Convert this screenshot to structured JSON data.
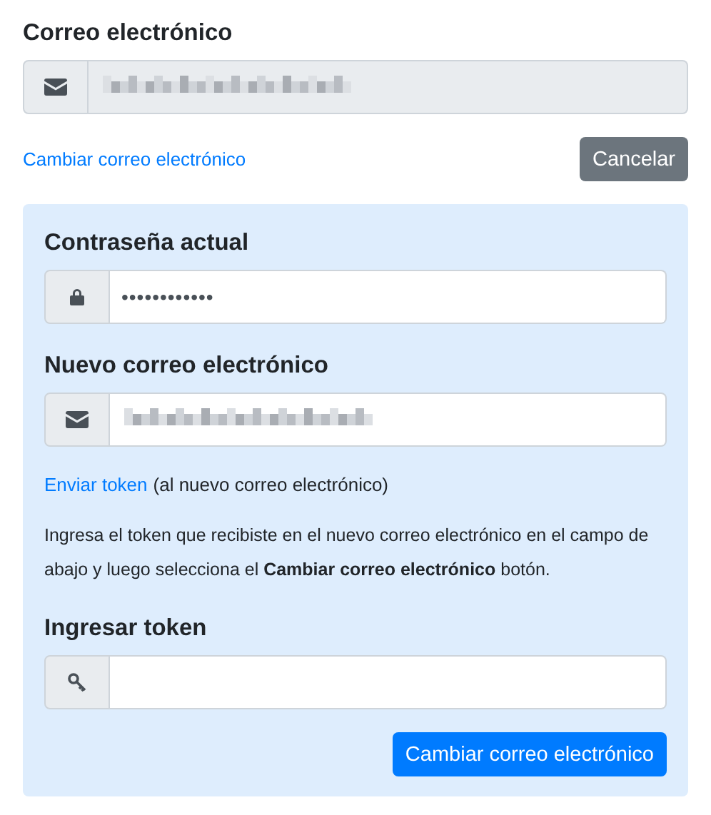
{
  "current_email": {
    "label": "Correo electrónico",
    "kind": "email",
    "disabled": true,
    "obscured": true
  },
  "change_link": "Cambiar correo electrónico",
  "cancel_button": "Cancelar",
  "panel": {
    "fields": [
      {
        "label": "Contraseña actual",
        "kind": "password",
        "disabled": false,
        "value": "••••••••••••"
      },
      {
        "label": "Nuevo correo electrónico",
        "kind": "email",
        "disabled": false,
        "obscured": true
      }
    ],
    "send_token_link": "Enviar token",
    "send_token_note": "(al nuevo correo electrónico)",
    "instructions": "Ingresa el token que recibiste en el nuevo correo electrónico en el campo de abajo y luego selecciona el **Cambiar correo electrónico** botón.",
    "token_field": {
      "label": "Ingresar token",
      "kind": "token",
      "disabled": false
    },
    "submit_button": "Cambiar correo electrónico"
  }
}
